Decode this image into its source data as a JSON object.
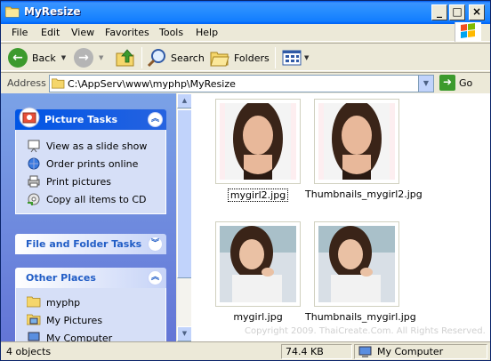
{
  "window": {
    "title": "MyResize"
  },
  "menu": [
    "File",
    "Edit",
    "View",
    "Favorites",
    "Tools",
    "Help"
  ],
  "toolbar": {
    "back": "Back",
    "search": "Search",
    "folders": "Folders"
  },
  "address": {
    "label": "Address",
    "path": "C:\\AppServ\\www\\myphp\\MyResize",
    "go": "Go"
  },
  "tasks": {
    "picture": {
      "title": "Picture Tasks",
      "items": [
        "View as a slide show",
        "Order prints online",
        "Print pictures",
        "Copy all items to CD"
      ]
    },
    "file_folder": {
      "title": "File and Folder Tasks"
    },
    "other": {
      "title": "Other Places",
      "items": [
        "myphp",
        "My Pictures",
        "My Computer"
      ]
    }
  },
  "files": [
    "mygirl2.jpg",
    "Thumbnails_mygirl2.jpg",
    "mygirl.jpg",
    "Thumbnails_mygirl.jpg"
  ],
  "watermark": "Copyright 2009. ThaiCreate.Com. All Rights Reserved.",
  "status": {
    "count": "4 objects",
    "size": "74.4 KB",
    "location": "My Computer"
  },
  "colors": {
    "title_blue": "#0058ee",
    "pane_blue": "#7ba2e7",
    "task_bg": "#d6dff7"
  }
}
